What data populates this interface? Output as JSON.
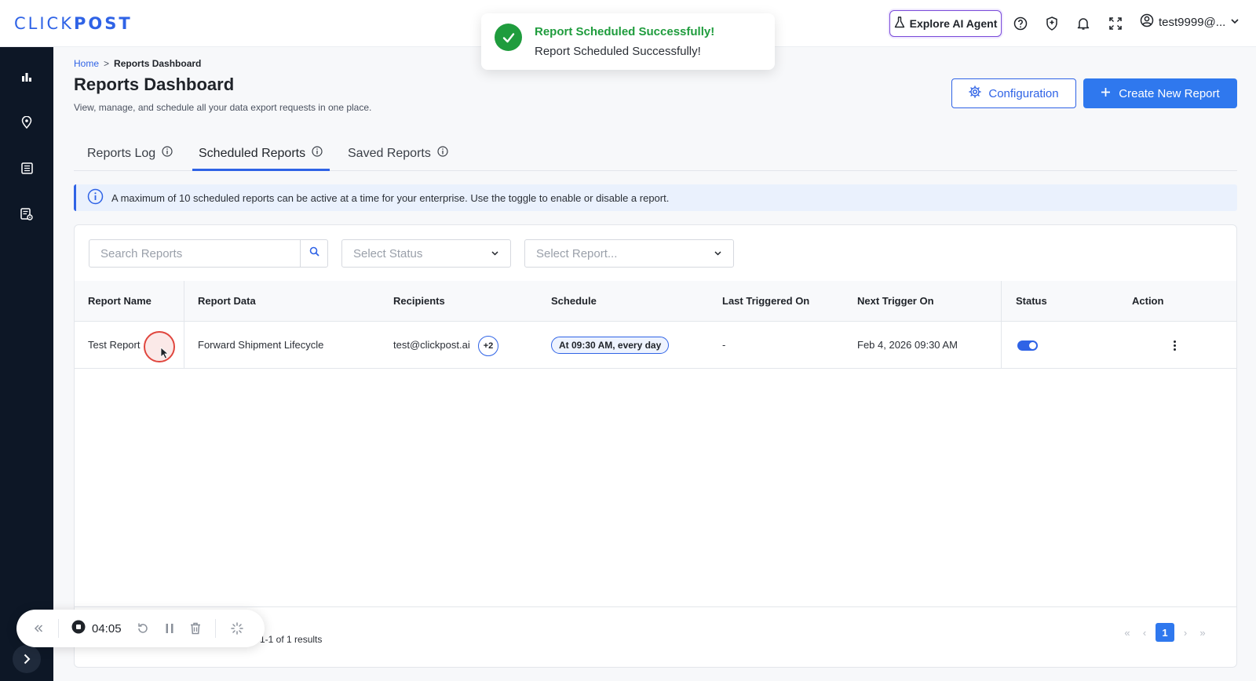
{
  "header": {
    "logo_light": "CLICK",
    "logo_bold": "POST",
    "ai_agent_label": "Explore AI Agent",
    "user_label": "test9999@..."
  },
  "toast": {
    "title": "Report Scheduled Successfully!",
    "message": "Report Scheduled Successfully!"
  },
  "breadcrumb": {
    "home": "Home",
    "separator": ">",
    "current": "Reports Dashboard"
  },
  "page": {
    "title": "Reports Dashboard",
    "subtitle": "View, manage, and schedule all your data export requests in one place.",
    "configuration_label": "Configuration",
    "create_label": "Create New Report"
  },
  "tabs": [
    {
      "label": "Reports Log"
    },
    {
      "label": "Scheduled Reports",
      "active": true
    },
    {
      "label": "Saved Reports"
    }
  ],
  "info_message": "A maximum of 10 scheduled reports can be active at a time for your enterprise. Use the toggle to enable or disable a report.",
  "filters": {
    "search_placeholder": "Search Reports",
    "status_placeholder": "Select Status",
    "report_placeholder": "Select Report..."
  },
  "table": {
    "columns": [
      "Report Name",
      "Report Data",
      "Recipients",
      "Schedule",
      "Last Triggered On",
      "Next Trigger On",
      "Status",
      "Action"
    ],
    "rows": [
      {
        "report_name": "Test Report",
        "report_data": "Forward Shipment Lifecycle",
        "recipient": "test@clickpost.ai",
        "extra_recipients": "+2",
        "schedule": "At 09:30 AM, every day",
        "last_triggered": "-",
        "next_trigger": "Feb 4, 2026 09:30 AM",
        "status_enabled": true
      }
    ]
  },
  "footer": {
    "results": "1-1 of 1 results",
    "current_page": "1"
  },
  "recorder": {
    "time": "04:05"
  },
  "colors": {
    "brand": "#2f63e6",
    "success": "#1f9c3d",
    "sidebar": "#0d1726",
    "ai_border": "#7a4bd8"
  }
}
